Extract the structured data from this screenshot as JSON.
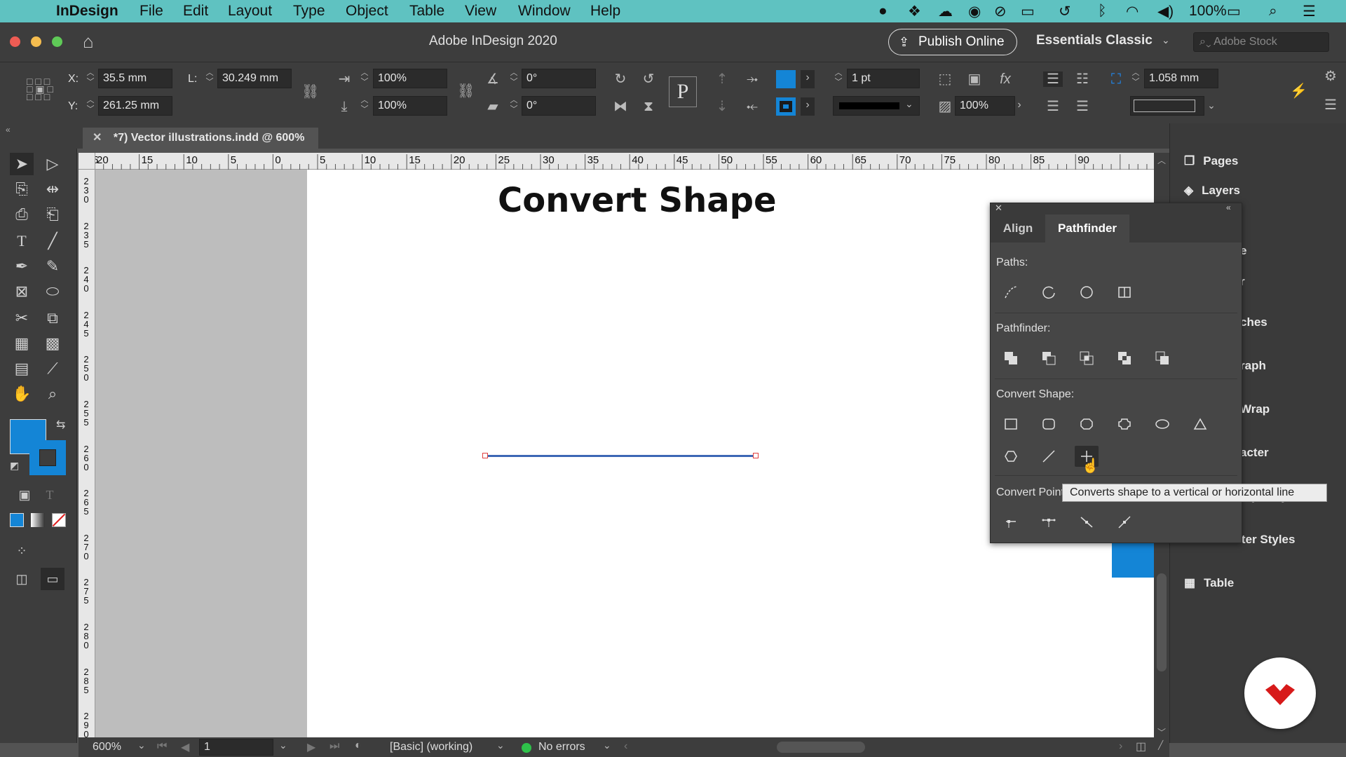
{
  "menubar": {
    "app_name": "InDesign",
    "items": [
      "File",
      "Edit",
      "Layout",
      "Type",
      "Object",
      "Table",
      "View",
      "Window",
      "Help"
    ],
    "battery": "100%"
  },
  "titlebar": {
    "title": "Adobe InDesign 2020",
    "publish_label": "Publish Online",
    "workspace": "Essentials Classic",
    "stock_placeholder": "Adobe Stock"
  },
  "control": {
    "x_label": "X:",
    "x_value": "35.5 mm",
    "y_label": "Y:",
    "y_value": "261.25 mm",
    "l_label": "L:",
    "l_value": "30.249 mm",
    "scale_x": "100%",
    "scale_y": "100%",
    "rotate": "0°",
    "shear": "0°",
    "stroke_weight": "1 pt",
    "opacity": "100%",
    "offset": "1.058 mm"
  },
  "document": {
    "tab_title": "*7) Vector illustrations.indd @ 600%",
    "heading": "Convert Shape",
    "ruler_h": [
      "5",
      "20",
      "15",
      "10",
      "5",
      "0",
      "5",
      "10",
      "15",
      "20",
      "25",
      "30",
      "35",
      "40",
      "45",
      "50",
      "55",
      "60",
      "65",
      "70",
      "75",
      "80",
      "85",
      "90"
    ],
    "ruler_v": [
      "230",
      "235",
      "240",
      "245",
      "250",
      "255",
      "260",
      "265",
      "270",
      "275",
      "280",
      "285",
      "290"
    ]
  },
  "pathfinder_panel": {
    "tabs": [
      "Align",
      "Pathfinder"
    ],
    "active_tab": "Pathfinder",
    "paths_label": "Paths:",
    "pathfinder_label": "Pathfinder:",
    "convert_shape_label": "Convert Shape:",
    "convert_point_label": "Convert Point:",
    "tooltip": "Converts shape to a vertical or horizontal line"
  },
  "right_panel": {
    "items": [
      "Pages",
      "Layers",
      "e",
      "r",
      "ches",
      "raph",
      "Wrap",
      "acter",
      "raph Styles",
      "Character Styles",
      "Table"
    ]
  },
  "status": {
    "zoom": "600%",
    "page": "1",
    "preflight_profile": "[Basic] (working)",
    "errors": "No errors"
  },
  "colors": {
    "menubar_bg": "#5fc2c1",
    "accent_blue": "#1485d6",
    "line_color": "#3d67b5"
  }
}
